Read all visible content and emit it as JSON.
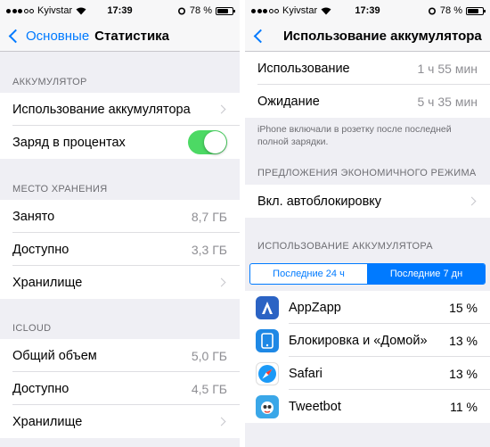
{
  "left": {
    "status": {
      "carrier": "Kyivstar",
      "time": "17:39",
      "battery": "78 %",
      "battery_level": 0.78
    },
    "nav": {
      "back_label": "Основные",
      "title": "Статистика"
    },
    "battery_section": {
      "header": "АККУМУЛЯТОР",
      "usage_label": "Использование аккумулятора",
      "percent_label": "Заряд в процентах",
      "percent_on": true
    },
    "storage_section": {
      "header": "МЕСТО ХРАНЕНИЯ",
      "used_label": "Занято",
      "used_value": "8,7 ГБ",
      "available_label": "Доступно",
      "available_value": "3,3 ГБ",
      "manage_label": "Хранилище"
    },
    "icloud_section": {
      "header": "ICLOUD",
      "total_label": "Общий объем",
      "total_value": "5,0 ГБ",
      "available_label": "Доступно",
      "available_value": "4,5 ГБ",
      "manage_label": "Хранилище"
    }
  },
  "right": {
    "status": {
      "carrier": "Kyivstar",
      "time": "17:39",
      "battery": "78 %",
      "battery_level": 0.78
    },
    "nav": {
      "title": "Использование аккумулятора"
    },
    "usage": {
      "usage_label": "Использование",
      "usage_value": "1 ч 55 мин",
      "standby_label": "Ожидание",
      "standby_value": "5 ч 35 мин",
      "note": "iPhone включали в розетку после последней полной зарядки."
    },
    "suggestions": {
      "header": "ПРЕДЛОЖЕНИЯ ЭКОНОМИЧНОГО РЕЖИМА",
      "autolock_label": "Вкл. автоблокировку"
    },
    "battery_usage": {
      "header": "ИСПОЛЬЗОВАНИЕ АККУМУЛЯТОРА",
      "segments": [
        "Последние 24 ч",
        "Последние 7 дн"
      ],
      "active_segment": 1,
      "apps": [
        {
          "name": "AppZapp",
          "percent": "15 %",
          "icon": "appzapp-icon",
          "color": "#2b63c4"
        },
        {
          "name": "Блокировка и «Домой»",
          "percent": "13 %",
          "icon": "lock-home-icon",
          "color": "#1e88e5"
        },
        {
          "name": "Safari",
          "percent": "13 %",
          "icon": "safari-icon",
          "color": "#1b9af7"
        },
        {
          "name": "Tweetbot",
          "percent": "11 %",
          "icon": "tweetbot-icon",
          "color": "#3aa7e8"
        }
      ]
    }
  },
  "colors": {
    "accent": "#007aff",
    "toggle_on": "#4cd964",
    "background": "#efeff4"
  }
}
